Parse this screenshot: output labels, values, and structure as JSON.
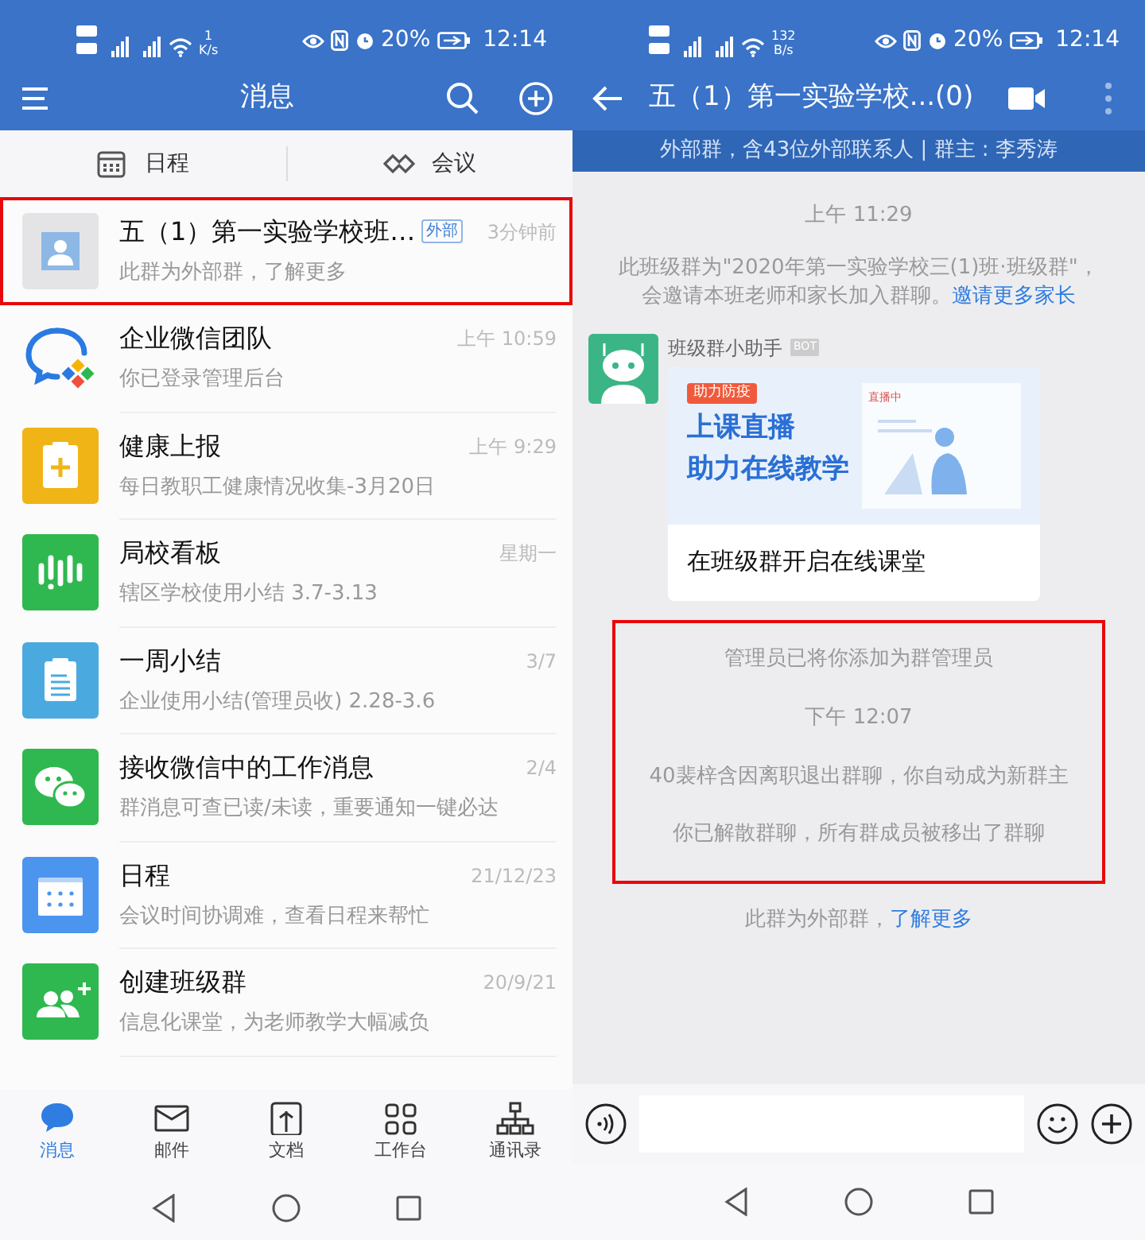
{
  "left_screen": {
    "status_bar": {
      "net_speed": "1",
      "net_unit": "K/s",
      "battery": "20%",
      "time": "12:14"
    },
    "header": {
      "title": "消息"
    },
    "shortcuts": [
      {
        "kind": "calendar",
        "label": "日程"
      },
      {
        "kind": "meeting",
        "label": "会议"
      }
    ],
    "conversations": [
      {
        "kind": "group",
        "name": "五（1）第一实验学校班…",
        "tag": "外部",
        "time": "3分钟前",
        "preview": "此群为外部群，了解更多",
        "highlighted": true
      },
      {
        "kind": "wecom",
        "name": "企业微信团队",
        "time": "上午 10:59",
        "preview": "你已登录管理后台",
        "highlighted": false
      },
      {
        "kind": "health",
        "name": "健康上报",
        "time": "上午 9:29",
        "preview": "每日教职工健康情况收集-3月20日",
        "highlighted": false
      },
      {
        "kind": "board",
        "name": "局校看板",
        "time": "星期一",
        "preview": "辖区学校使用小结 3.7-3.13",
        "highlighted": false
      },
      {
        "kind": "summary",
        "name": "一周小结",
        "time": "3/7",
        "preview": "企业使用小结(管理员收) 2.28-3.6",
        "highlighted": false
      },
      {
        "kind": "wechat",
        "name": "接收微信中的工作消息",
        "time": "2/4",
        "preview": "群消息可查已读/未读，重要通知一键必达",
        "highlighted": false
      },
      {
        "kind": "calendar",
        "name": "日程",
        "time": "21/12/23",
        "preview": "会议时间协调难，查看日程来帮忙",
        "highlighted": false
      },
      {
        "kind": "classgroup",
        "name": "创建班级群",
        "time": "20/9/21",
        "preview": "信息化课堂，为老师教学大幅减负",
        "highlighted": false
      }
    ],
    "tab_bar": [
      {
        "kind": "chat",
        "label": "消息",
        "selected": true
      },
      {
        "kind": "mail",
        "label": "邮件",
        "selected": false
      },
      {
        "kind": "doc",
        "label": "文档",
        "selected": false
      },
      {
        "kind": "grid",
        "label": "工作台",
        "selected": false
      },
      {
        "kind": "org",
        "label": "通讯录",
        "selected": false
      }
    ]
  },
  "right_screen": {
    "status_bar": {
      "net_speed": "132",
      "net_unit": "B/s",
      "battery": "20%",
      "time": "12:14"
    },
    "header": {
      "title": "五（1）第一实验学校...(0)"
    },
    "info_bar": "外部群，含43位外部联系人 | 群主 : 李秀涛",
    "messages": [
      {
        "kind": "time",
        "text": "上午 11:29"
      },
      {
        "kind": "system",
        "text": "此班级群为\"2020年第一实验学校三(1)班·班级群\"，会邀请本班老师和家长加入群聊。",
        "link": "邀请更多家长"
      },
      {
        "kind": "bot_card",
        "sender": "班级群小助手",
        "badge": "BOT",
        "card": {
          "tag": "助力防疫",
          "headline": [
            "上课直播",
            "助力在线教学"
          ],
          "live_label": "直播中",
          "caption": "在班级群开启在线课堂"
        }
      },
      {
        "kind": "group",
        "highlighted": true,
        "items": [
          {
            "kind": "system",
            "text": "管理员已将你添加为群管理员"
          },
          {
            "kind": "time",
            "text": "下午 12:07"
          },
          {
            "kind": "system",
            "text": "40裴梓含因离职退出群聊，你自动成为新群主"
          },
          {
            "kind": "system",
            "text": "你已解散群聊，所有群成员被移出了群聊"
          }
        ]
      },
      {
        "kind": "system",
        "text": "此群为外部群，",
        "link": "了解更多"
      }
    ]
  }
}
